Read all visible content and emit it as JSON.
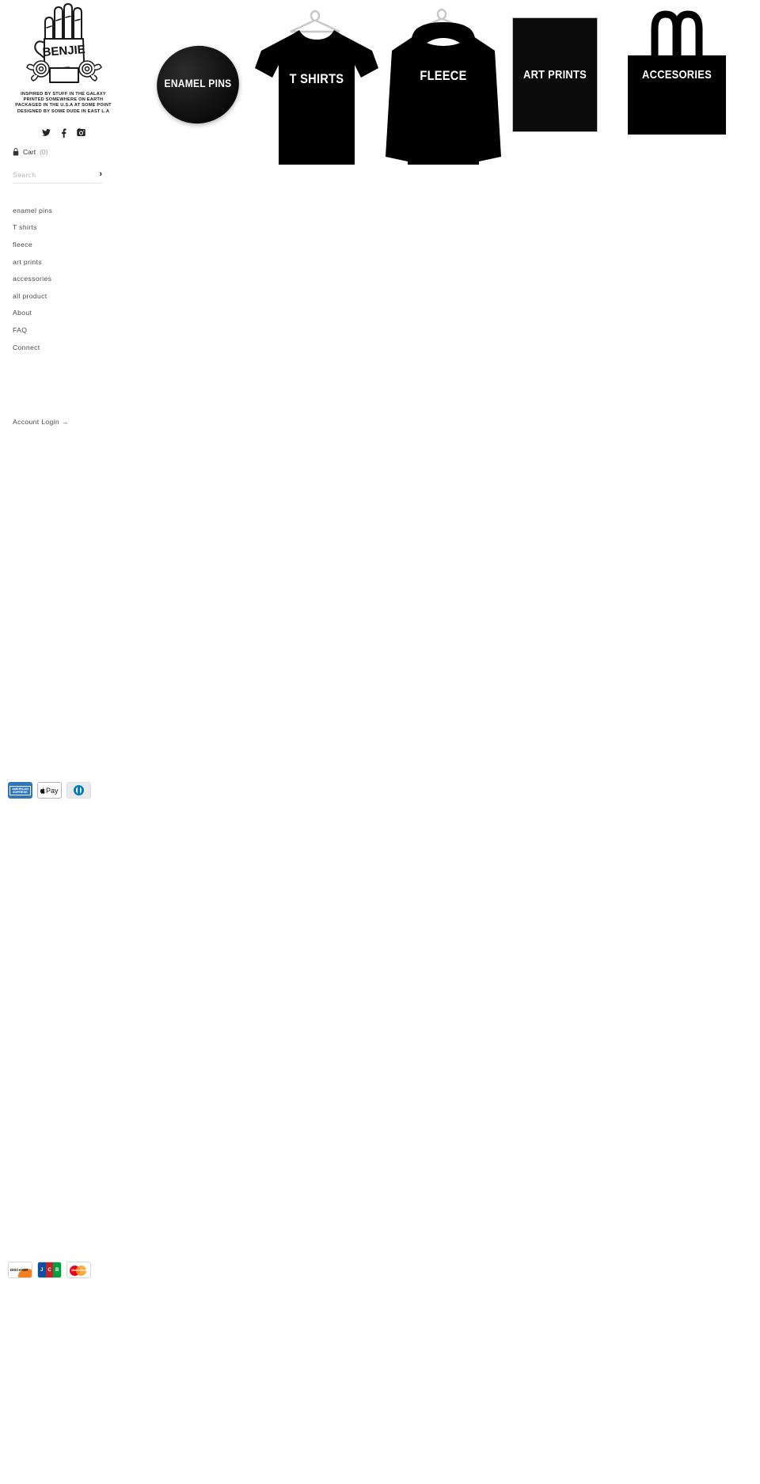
{
  "brand": {
    "name": "BENJIE",
    "logo_icon": "hand-with-roses-logo",
    "tagline": [
      "INSPIRED BY STUFF IN THE GALAXY",
      "PRINTED SOMEWHERE ON EARTH",
      "PACKAGED IN THE U.S.A AT SOME POINT",
      "DESIGNED BY SOME DUDE IN EAST L.A"
    ]
  },
  "social": [
    {
      "name": "twitter-icon",
      "label": "Twitter"
    },
    {
      "name": "facebook-icon",
      "label": "Facebook"
    },
    {
      "name": "instagram-icon",
      "label": "Instagram"
    }
  ],
  "cart": {
    "icon": "lock-icon",
    "label": "Cart",
    "count": "(0)"
  },
  "search": {
    "placeholder": "Search",
    "submit_label": "›",
    "value": ""
  },
  "nav": {
    "items": [
      {
        "label": "enamel pins",
        "key": "enamel-pins"
      },
      {
        "label": "T shirts",
        "key": "t-shirts"
      },
      {
        "label": "fleece",
        "key": "fleece"
      },
      {
        "label": "art prints",
        "key": "art-prints"
      },
      {
        "label": "accessories",
        "key": "accessories"
      },
      {
        "label": "all product",
        "key": "all-product"
      },
      {
        "label": "About",
        "key": "about"
      },
      {
        "label": "FAQ",
        "key": "faq"
      },
      {
        "label": "Connect",
        "key": "connect"
      }
    ]
  },
  "account": {
    "login_label": "Account Login →"
  },
  "payments": {
    "row_one": [
      {
        "key": "amex",
        "label": "AMERICAN EXPRESS",
        "short": "AMERICAN\nEXPRESS"
      },
      {
        "key": "apple-pay",
        "label": "Apple Pay",
        "short": "Pay"
      },
      {
        "key": "diners-club",
        "label": "Diners Club",
        "short": "D"
      }
    ],
    "row_two": [
      {
        "key": "discover",
        "label": "DISCOVER",
        "short": "DISC●VER"
      },
      {
        "key": "jcb",
        "label": "JCB",
        "short": "JCB"
      },
      {
        "key": "mastercard",
        "label": "MasterCard",
        "short": "MasterCard"
      }
    ]
  },
  "tiles": [
    {
      "key": "enamel-pins",
      "label": "ENAMEL PINS",
      "art": "round-black-pin"
    },
    {
      "key": "t-shirts",
      "label": "T SHIRTS",
      "art": "black-tshirt-on-hanger"
    },
    {
      "key": "fleece",
      "label": "FLEECE",
      "art": "black-hoodie-on-hanger"
    },
    {
      "key": "art-prints",
      "label": "ART PRINTS",
      "art": "framed-black-print"
    },
    {
      "key": "accessories",
      "label": "ACCESORIES",
      "art": "black-tote-bag"
    }
  ],
  "colors": {
    "background": "#ffffff",
    "text": "#4a4a4a",
    "product_black": "#000000",
    "placeholder": "#b3b3b3"
  }
}
